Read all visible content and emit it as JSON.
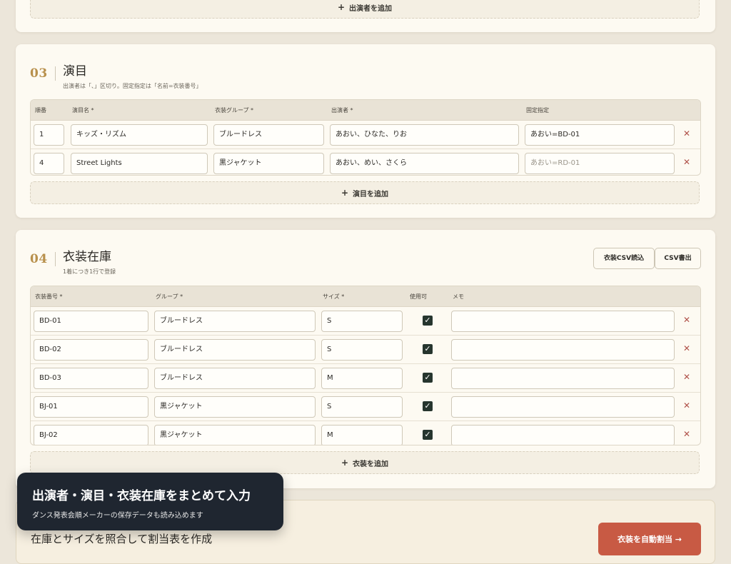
{
  "performers_section": {
    "add_label": "出演者を追加"
  },
  "programs_section": {
    "number": "03",
    "title": "演目",
    "subtitle": "出演者は「、」区切り。固定指定は「名前=衣装番号」",
    "columns": [
      "順番",
      "演目名 *",
      "衣装グループ *",
      "出演者 *",
      "固定指定"
    ],
    "rows": [
      {
        "order": "1",
        "name": "キッズ・リズム",
        "group": "ブルードレス",
        "performers": "あおい、ひなた、りお",
        "fixed": "あおい=BD-01",
        "fixed_placeholder": false
      },
      {
        "order": "4",
        "name": "Street Lights",
        "group": "黒ジャケット",
        "performers": "あおい、めい、さくら",
        "fixed": "あおい=RD-01",
        "fixed_placeholder": true
      }
    ],
    "add_label": "演目を追加"
  },
  "inventory_section": {
    "number": "04",
    "title": "衣装在庫",
    "subtitle": "1着につき1行で登録",
    "import_label": "衣装CSV読込",
    "export_label": "CSV書出",
    "columns": [
      "衣装番号 *",
      "グループ *",
      "サイズ *",
      "使用可",
      "メモ"
    ],
    "rows": [
      {
        "code": "BD-01",
        "group": "ブルードレス",
        "size": "S",
        "available": true,
        "memo": ""
      },
      {
        "code": "BD-02",
        "group": "ブルードレス",
        "size": "S",
        "available": true,
        "memo": ""
      },
      {
        "code": "BD-03",
        "group": "ブルードレス",
        "size": "M",
        "available": true,
        "memo": ""
      },
      {
        "code": "BJ-01",
        "group": "黒ジャケット",
        "size": "S",
        "available": true,
        "memo": ""
      },
      {
        "code": "BJ-02",
        "group": "黒ジャケット",
        "size": "M",
        "available": true,
        "memo": ""
      }
    ],
    "add_label": "衣装を追加"
  },
  "toast": {
    "title": "出演者・演目・衣装在庫をまとめて入力",
    "subtitle": "ダンス発表会順メーカーの保存データも読み込めます"
  },
  "assign_section": {
    "title": "在庫とサイズを照合して割当表を作成",
    "button_label": "衣装を自動割当 →"
  },
  "icons": {
    "add": "plus-icon",
    "delete": "close-icon",
    "check": "check-icon"
  },
  "colors": {
    "accent": "#b8904c",
    "danger": "#b0524a",
    "cta": "#c85a44",
    "toast_bg": "#1f2630",
    "checkbox": "#26352e"
  }
}
